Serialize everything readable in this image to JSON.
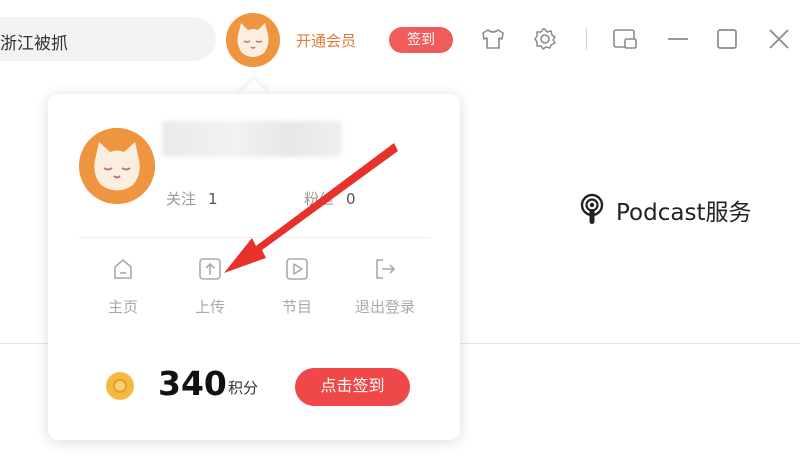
{
  "titlebar": {
    "search_text": "浙江被抓",
    "vip_label": "开通会员",
    "signin_label": "签到",
    "icons": [
      "skin-icon",
      "gear-icon",
      "mini-mode-icon",
      "minimize-icon",
      "maximize-icon",
      "close-icon"
    ]
  },
  "background": {
    "podcast_label": "Podcast服务"
  },
  "popup": {
    "follow_label": "关注",
    "follow_count": "1",
    "fans_label": "粉丝",
    "fans_count": "0",
    "actions": [
      {
        "label": "主页",
        "icon": "home-icon"
      },
      {
        "label": "上传",
        "icon": "upload-icon"
      },
      {
        "label": "节目",
        "icon": "program-icon"
      },
      {
        "label": "退出登录",
        "icon": "logout-icon"
      }
    ],
    "points_value": "340",
    "points_unit": "积分",
    "checkin_label": "点击签到"
  },
  "colors": {
    "accent_orange": "#f0953f",
    "signin_red": "#f05c5c",
    "checkin_red": "#f04848",
    "arrow_red": "#e8312a"
  }
}
